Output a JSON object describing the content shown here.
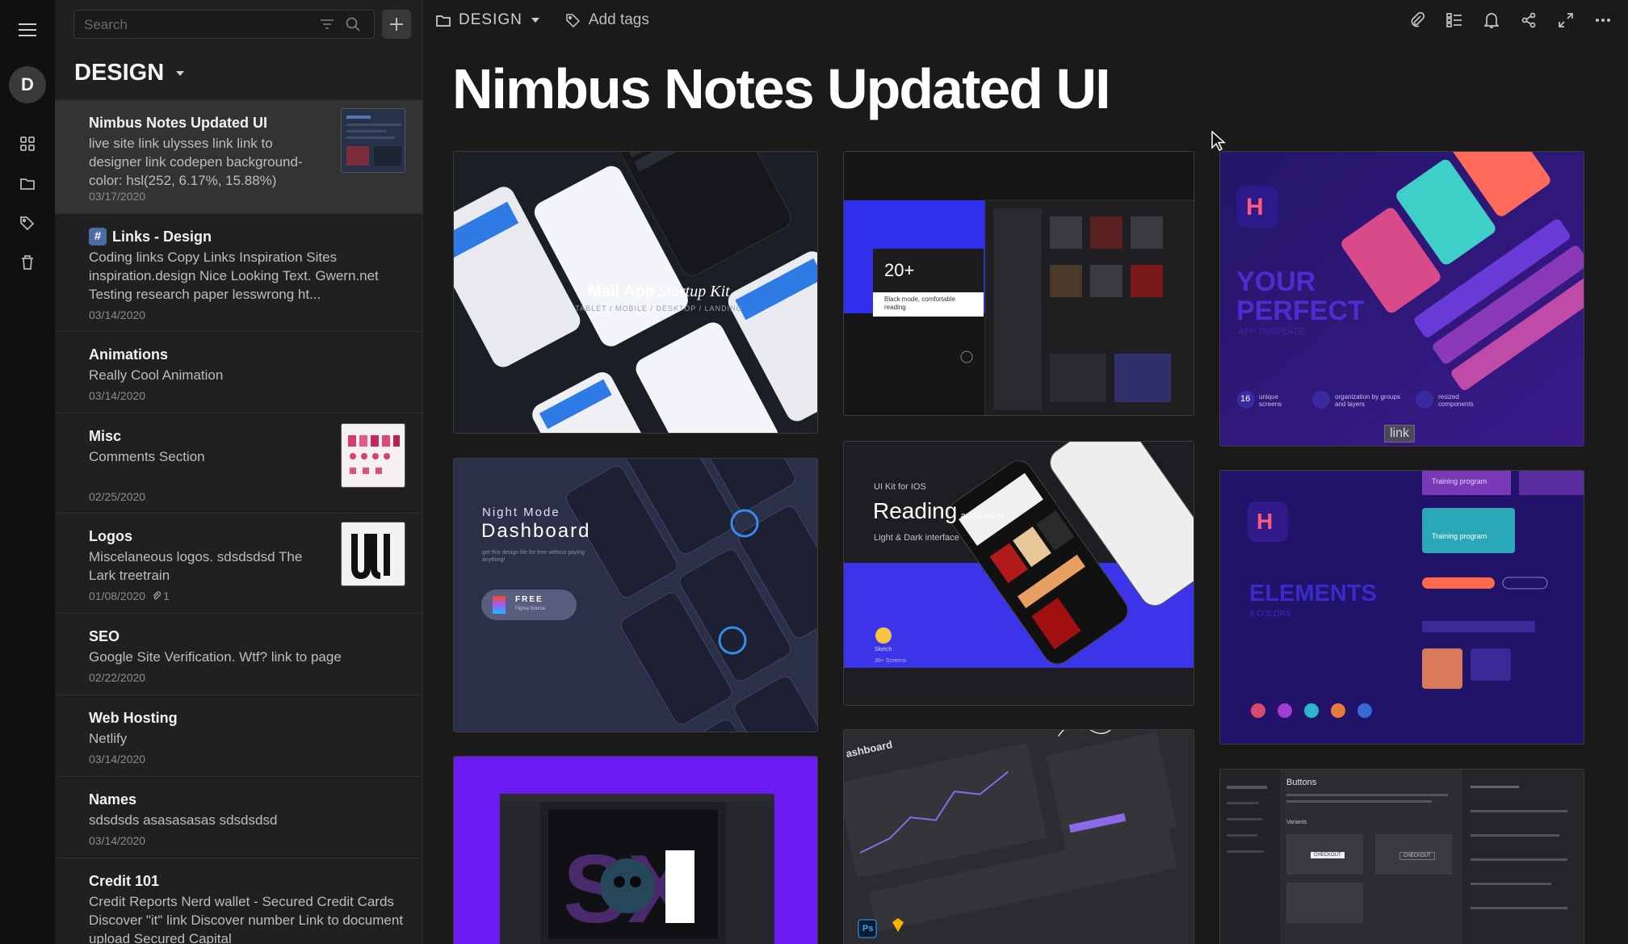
{
  "rail": {
    "avatar_letter": "D",
    "icons": [
      "menu-icon",
      "grid-icon",
      "folder-icon",
      "tag-icon",
      "trash-icon"
    ]
  },
  "list": {
    "search_placeholder": "Search",
    "folder_title": "DESIGN",
    "notes": [
      {
        "title": "Nimbus Notes Updated UI",
        "snippet": "live site link ulysses link link to designer link codepen background-color: hsl(252, 6.17%, 15.88%)",
        "date": "03/17/2020"
      },
      {
        "title": "Links - Design",
        "snippet": "Coding links Copy Links Inspiration Sites inspiration.design Nice Looking Text. Gwern.net Testing research paper lesswrong ht...",
        "date": "03/14/2020"
      },
      {
        "title": "Animations",
        "snippet": "Really Cool Animation",
        "date": "03/14/2020"
      },
      {
        "title": "Misc",
        "snippet": "Comments Section",
        "date": "02/25/2020"
      },
      {
        "title": "Logos",
        "snippet": "Miscelaneous logos. sdsdsdsd The Lark treetrain",
        "date": "01/08/2020",
        "attachments": "1"
      },
      {
        "title": "SEO",
        "snippet": "Google Site Verification. Wtf? link to page",
        "date": "02/22/2020"
      },
      {
        "title": "Web Hosting",
        "snippet": "Netlify",
        "date": "03/14/2020"
      },
      {
        "title": "Names",
        "snippet": "sdsdsds asasasasas sdsdsdsd",
        "date": "03/14/2020"
      },
      {
        "title": "Credit 101",
        "snippet": "Credit Reports Nerd wallet - Secured Credit Cards Discover \"it\" link Discover number Link to document upload Secured Capital",
        "date": ""
      }
    ]
  },
  "main": {
    "folder": "DESIGN",
    "add_tags": "Add tags",
    "title": "Nimbus Notes Updated UI",
    "toolbar_icons": [
      "attachment-icon",
      "outline-icon",
      "bell-icon",
      "share-icon",
      "expand-icon",
      "more-icon"
    ],
    "cards": {
      "mail": {
        "title": "Mail App",
        "script": "Startup Kit",
        "sub": "TABLET / MOBILE / DESKTOP / LANDING"
      },
      "dark": {
        "count": "20+",
        "caption": "Black mode, comfortable reading"
      },
      "perfect": {
        "line1": "YOUR",
        "line2": "PERFECT",
        "line3": "APP TEMPLATE",
        "stat1_num": "16",
        "stat1_label": "unique screens",
        "stat2_label": "organization by groups and layers",
        "stat3_label": "resized components",
        "link_label": "link"
      },
      "dashboard": {
        "small": "Night Mode",
        "big": "Dashboard",
        "caption": "get this design file for free without paying anything!",
        "free": "FREE",
        "free_sub": "Figma Source"
      },
      "reading": {
        "kicker": "UI Kit for IOS",
        "big": "Reading",
        "small": "application",
        "sub": "Light & Dark interface",
        "sketch": "Sketch",
        "screens": "36+ Screens"
      },
      "elements": {
        "title": "ELEMENTS",
        "sub": "6 COLORS",
        "training": "Training program"
      },
      "analytics": {
        "title": "ashboard",
        "ps": "Ps"
      },
      "buttons": {
        "title": "Buttons",
        "variants": "Variants",
        "checkout": "CHECKOUT"
      }
    }
  }
}
